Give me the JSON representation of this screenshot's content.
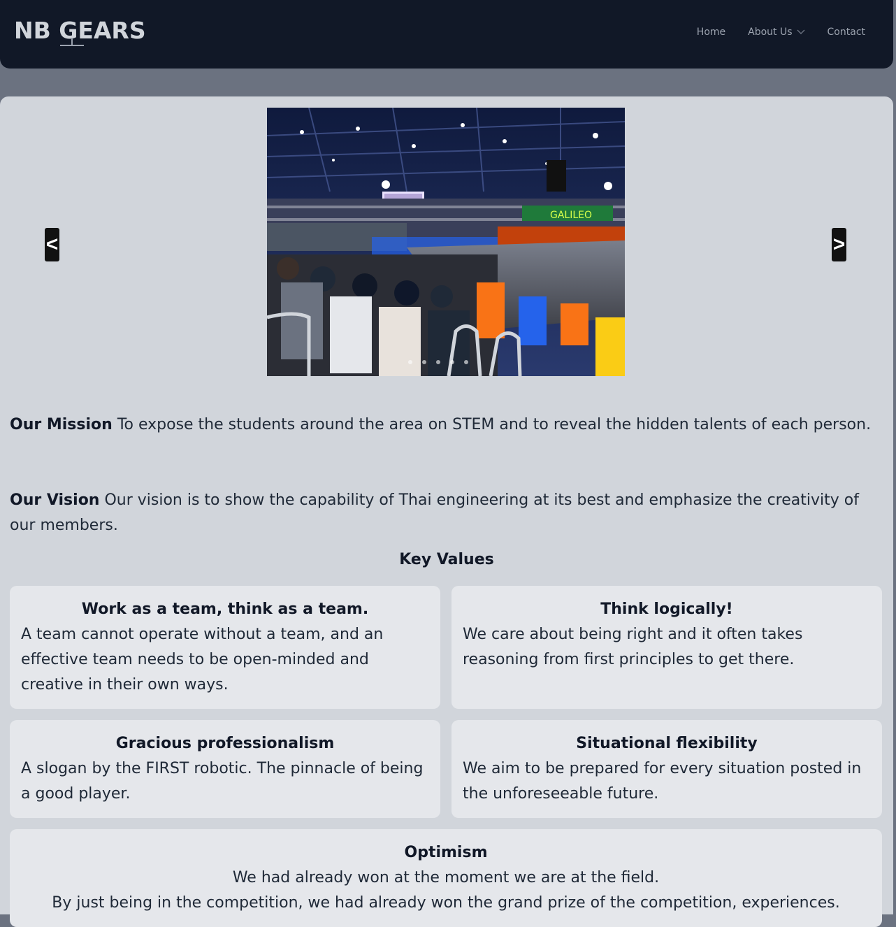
{
  "logo": {
    "text": "NB GEARS"
  },
  "nav": {
    "home": "Home",
    "about": "About Us",
    "contact": "Contact",
    "about_icon": "chevron-down-icon"
  },
  "carousel": {
    "prev_label": "<",
    "next_label": ">",
    "banner_text": "GALILEO"
  },
  "mission": {
    "label": "Our Mission",
    "text": " To expose the students around the area on STEM and to reveal the hidden talents of each person."
  },
  "vision": {
    "label": "Our Vision",
    "text": " Our vision is to show the capability of Thai engineering at its best and emphasize the creativity of our members."
  },
  "key_values": {
    "title": "Key Values",
    "items": [
      {
        "title": "Work as a team, think as a team.",
        "text": "A team cannot operate without a team, and an effective team needs to be open-minded and creative in their own ways."
      },
      {
        "title": "Think logically!",
        "text": "We care about being right and it often takes reasoning from first principles to get there."
      },
      {
        "title": "Gracious professionalism",
        "text": "A slogan by the FIRST robotic. The pinnacle of being a good player."
      },
      {
        "title": "Situational flexibility",
        "text": "We aim to be prepared for every situation posted in the unforeseeable future."
      },
      {
        "title": "Optimism",
        "text": "We had already won at the moment we are at the field.",
        "text2": "By just being in the competition, we had already won the grand prize of the competition, experiences."
      }
    ]
  },
  "colors": {
    "navbar": "#111827",
    "page_bg": "#6b7280",
    "panel": "#d1d5db",
    "card": "#e5e7eb"
  }
}
